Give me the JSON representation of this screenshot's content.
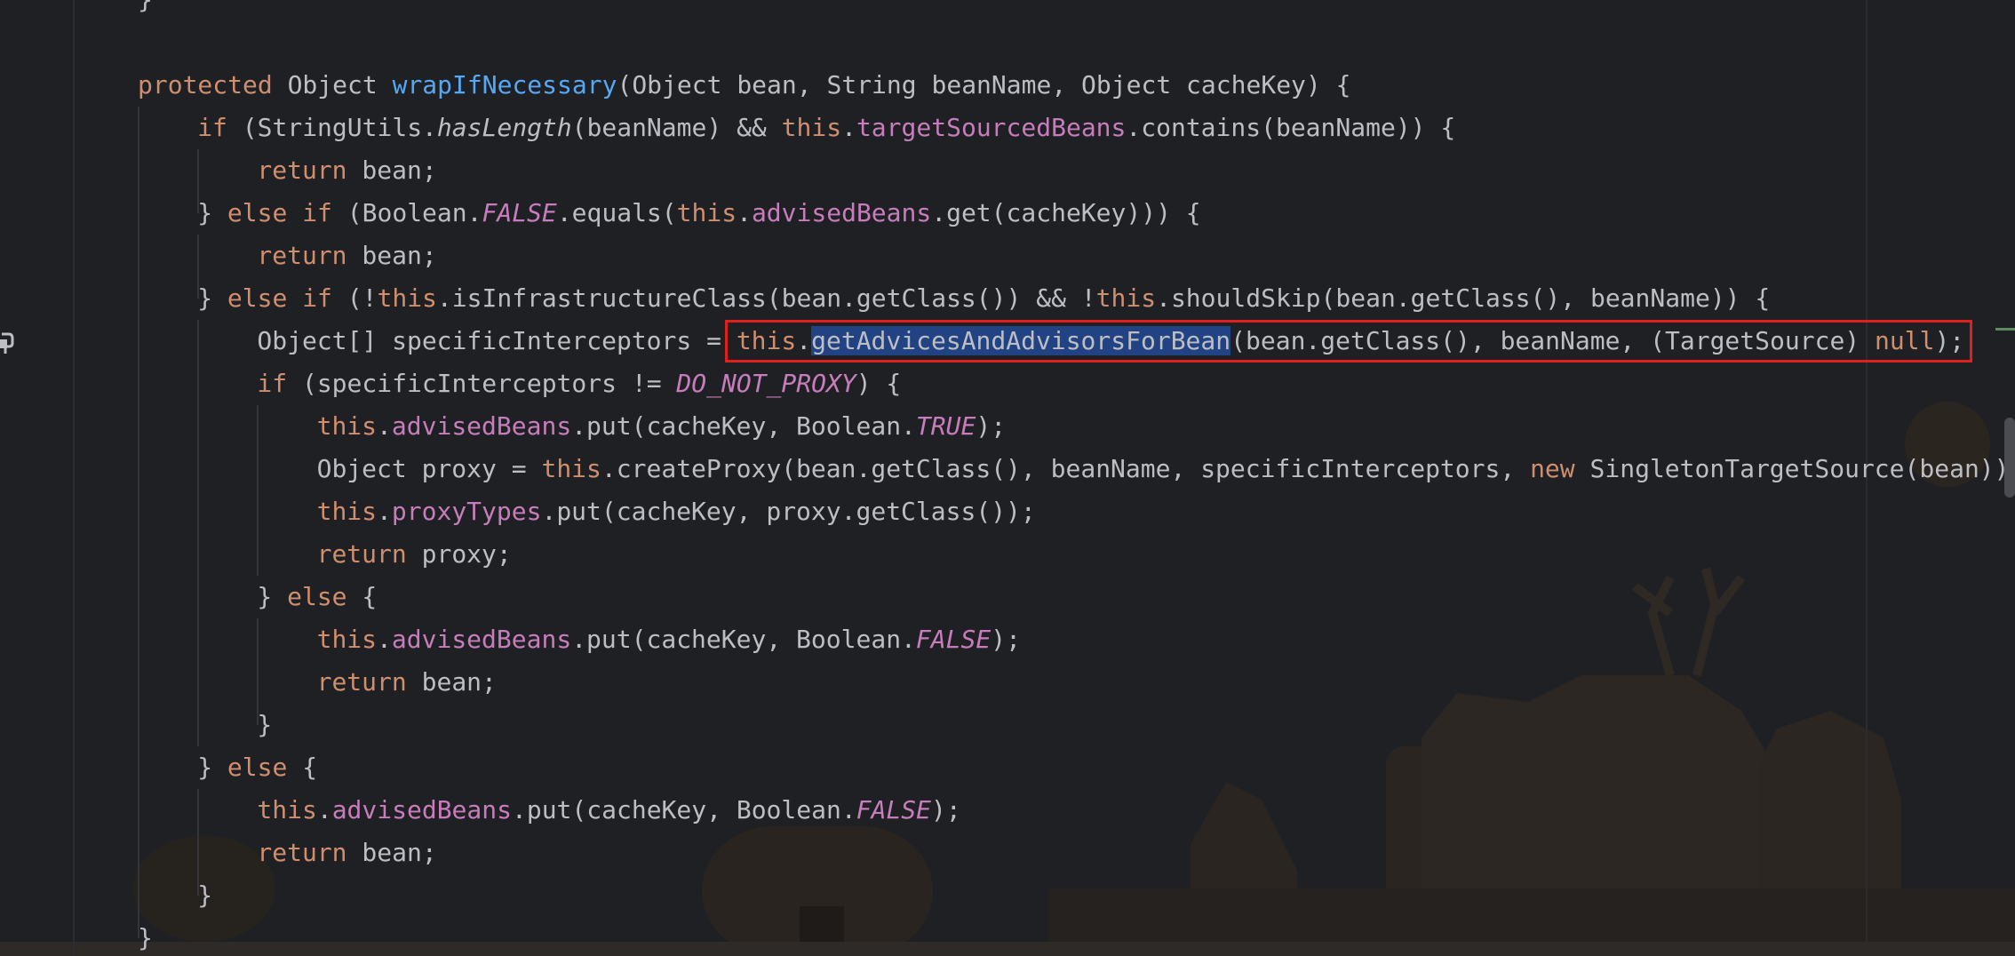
{
  "colors": {
    "background": "#1f2024",
    "keyword": "#cf8e6d",
    "method_declaration": "#56a8f5",
    "field": "#c77dbb",
    "plain": "#bcbec4",
    "selection": "#214283",
    "highlight_box": "#e0201e"
  },
  "icons": {
    "gutter": "bookmark-hook-icon"
  },
  "code": {
    "lines": [
      {
        "indent": 0,
        "tokens": [
          {
            "t": "}",
            "c": ""
          }
        ]
      },
      {
        "indent": 0,
        "tokens": []
      },
      {
        "indent": 0,
        "tokens": [
          {
            "t": "protected ",
            "c": "kw"
          },
          {
            "t": "Object ",
            "c": ""
          },
          {
            "t": "wrapIfNecessary",
            "c": "fn"
          },
          {
            "t": "(Object bean, String beanName, Object cacheKey) {",
            "c": ""
          }
        ]
      },
      {
        "indent": 1,
        "tokens": [
          {
            "t": "if ",
            "c": "kw"
          },
          {
            "t": "(StringUtils.",
            "c": ""
          },
          {
            "t": "hasLength",
            "c": "st"
          },
          {
            "t": "(beanName) && ",
            "c": ""
          },
          {
            "t": "this",
            "c": "kw"
          },
          {
            "t": ".",
            "c": ""
          },
          {
            "t": "targetSourcedBeans",
            "c": "fld"
          },
          {
            "t": ".contains(beanName)) {",
            "c": ""
          }
        ]
      },
      {
        "indent": 2,
        "tokens": [
          {
            "t": "return ",
            "c": "kw"
          },
          {
            "t": "bean;",
            "c": ""
          }
        ]
      },
      {
        "indent": 1,
        "tokens": [
          {
            "t": "} ",
            "c": ""
          },
          {
            "t": "else if ",
            "c": "kw"
          },
          {
            "t": "(Boolean.",
            "c": ""
          },
          {
            "t": "FALSE",
            "c": "const"
          },
          {
            "t": ".equals(",
            "c": ""
          },
          {
            "t": "this",
            "c": "kw"
          },
          {
            "t": ".",
            "c": ""
          },
          {
            "t": "advisedBeans",
            "c": "fld"
          },
          {
            "t": ".get(cacheKey))) {",
            "c": ""
          }
        ]
      },
      {
        "indent": 2,
        "tokens": [
          {
            "t": "return ",
            "c": "kw"
          },
          {
            "t": "bean;",
            "c": ""
          }
        ]
      },
      {
        "indent": 1,
        "tokens": [
          {
            "t": "} ",
            "c": ""
          },
          {
            "t": "else if ",
            "c": "kw"
          },
          {
            "t": "(!",
            "c": ""
          },
          {
            "t": "this",
            "c": "kw"
          },
          {
            "t": ".isInfrastructureClass(bean.getClass()) && !",
            "c": ""
          },
          {
            "t": "this",
            "c": "kw"
          },
          {
            "t": ".shouldSkip(bean.getClass(), beanName)) {",
            "c": ""
          }
        ]
      },
      {
        "indent": 2,
        "tokens": [
          {
            "t": "Object[] specificInterceptors = ",
            "c": ""
          },
          {
            "t": "this",
            "c": "kw"
          },
          {
            "t": ".",
            "c": ""
          },
          {
            "t": "getAdvicesAndAdvisorsForBean",
            "c": "sel"
          },
          {
            "t": "(bean.getClass(), beanName, (TargetSource) ",
            "c": ""
          },
          {
            "t": "null",
            "c": "kw"
          },
          {
            "t": ");",
            "c": ""
          }
        ]
      },
      {
        "indent": 2,
        "tokens": [
          {
            "t": "if ",
            "c": "kw"
          },
          {
            "t": "(specificInterceptors != ",
            "c": ""
          },
          {
            "t": "DO_NOT_PROXY",
            "c": "const"
          },
          {
            "t": ") {",
            "c": ""
          }
        ]
      },
      {
        "indent": 3,
        "tokens": [
          {
            "t": "this",
            "c": "kw"
          },
          {
            "t": ".",
            "c": ""
          },
          {
            "t": "advisedBeans",
            "c": "fld"
          },
          {
            "t": ".put(cacheKey, Boolean.",
            "c": ""
          },
          {
            "t": "TRUE",
            "c": "const"
          },
          {
            "t": ");",
            "c": ""
          }
        ]
      },
      {
        "indent": 3,
        "tokens": [
          {
            "t": "Object proxy = ",
            "c": ""
          },
          {
            "t": "this",
            "c": "kw"
          },
          {
            "t": ".createProxy(bean.getClass(), beanName, specificInterceptors, ",
            "c": ""
          },
          {
            "t": "new ",
            "c": "kw"
          },
          {
            "t": "SingletonTargetSource(bean));",
            "c": ""
          }
        ]
      },
      {
        "indent": 3,
        "tokens": [
          {
            "t": "this",
            "c": "kw"
          },
          {
            "t": ".",
            "c": ""
          },
          {
            "t": "proxyTypes",
            "c": "fld"
          },
          {
            "t": ".put(cacheKey, proxy.getClass());",
            "c": ""
          }
        ]
      },
      {
        "indent": 3,
        "tokens": [
          {
            "t": "return ",
            "c": "kw"
          },
          {
            "t": "proxy;",
            "c": ""
          }
        ]
      },
      {
        "indent": 2,
        "tokens": [
          {
            "t": "} ",
            "c": ""
          },
          {
            "t": "else ",
            "c": "kw"
          },
          {
            "t": "{",
            "c": ""
          }
        ]
      },
      {
        "indent": 3,
        "tokens": [
          {
            "t": "this",
            "c": "kw"
          },
          {
            "t": ".",
            "c": ""
          },
          {
            "t": "advisedBeans",
            "c": "fld"
          },
          {
            "t": ".put(cacheKey, Boolean.",
            "c": ""
          },
          {
            "t": "FALSE",
            "c": "const"
          },
          {
            "t": ");",
            "c": ""
          }
        ]
      },
      {
        "indent": 3,
        "tokens": [
          {
            "t": "return ",
            "c": "kw"
          },
          {
            "t": "bean;",
            "c": ""
          }
        ]
      },
      {
        "indent": 2,
        "tokens": [
          {
            "t": "}",
            "c": ""
          }
        ]
      },
      {
        "indent": 1,
        "tokens": [
          {
            "t": "} ",
            "c": ""
          },
          {
            "t": "else ",
            "c": "kw"
          },
          {
            "t": "{",
            "c": ""
          }
        ]
      },
      {
        "indent": 2,
        "tokens": [
          {
            "t": "this",
            "c": "kw"
          },
          {
            "t": ".",
            "c": ""
          },
          {
            "t": "advisedBeans",
            "c": "fld"
          },
          {
            "t": ".put(cacheKey, Boolean.",
            "c": ""
          },
          {
            "t": "FALSE",
            "c": "const"
          },
          {
            "t": ");",
            "c": ""
          }
        ]
      },
      {
        "indent": 2,
        "tokens": [
          {
            "t": "return ",
            "c": "kw"
          },
          {
            "t": "bean;",
            "c": ""
          }
        ]
      },
      {
        "indent": 1,
        "tokens": [
          {
            "t": "}",
            "c": ""
          }
        ]
      },
      {
        "indent": 0,
        "tokens": [
          {
            "t": "}",
            "c": ""
          }
        ]
      }
    ],
    "highlighted_line": 8
  }
}
